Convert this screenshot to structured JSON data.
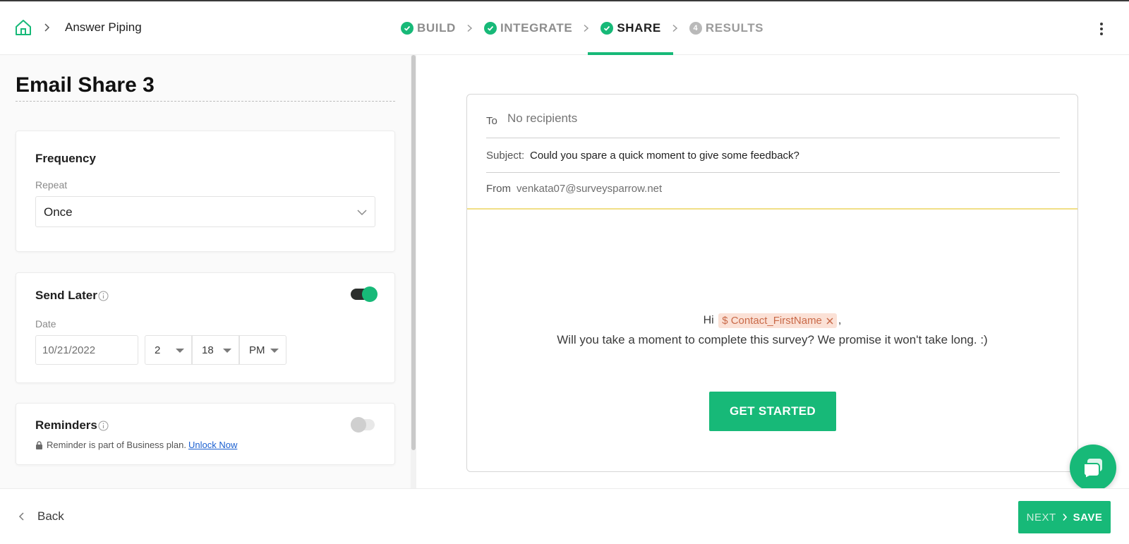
{
  "header": {
    "breadcrumb_title": "Answer Piping",
    "steps": [
      {
        "label": "BUILD",
        "state": "done"
      },
      {
        "label": "INTEGRATE",
        "state": "done"
      },
      {
        "label": "SHARE",
        "state": "active"
      },
      {
        "label": "RESULTS",
        "state": "todo",
        "number": "4"
      }
    ]
  },
  "left": {
    "title": "Email Share 3",
    "frequency": {
      "heading": "Frequency",
      "repeat_label": "Repeat",
      "repeat_value": "Once"
    },
    "send_later": {
      "heading": "Send Later",
      "enabled": true,
      "date_label": "Date",
      "date_value": "10/21/2022",
      "hour": "2",
      "minute": "18",
      "ampm": "PM"
    },
    "reminders": {
      "heading": "Reminders",
      "enabled": false,
      "note": "Reminder is part of Business plan.",
      "link": "Unlock Now"
    }
  },
  "email": {
    "to_label": "To",
    "to_placeholder": "No recipients",
    "subject_label": "Subject:",
    "subject_value": "Could you spare a quick moment to give some feedback?",
    "from_label": "From",
    "from_value": "venkata07@surveysparrow.net",
    "greeting": "Hi",
    "pipe_tag": "$ Contact_FirstName",
    "greeting_suffix": ",",
    "body": "Will you take a moment to complete this survey? We promise it won't take long. :)",
    "cta": "GET STARTED"
  },
  "footer": {
    "back": "Back",
    "next": "NEXT",
    "save": "SAVE"
  },
  "colors": {
    "accent": "#17b978",
    "pipe_tag_bg": "#fbe1d6",
    "pipe_tag_text": "#c96a49",
    "divider_yellow": "#f1df86"
  },
  "icons": [
    "home-icon",
    "chevron-right-icon",
    "check-circle-icon",
    "kebab-menu-icon",
    "chevron-down-icon",
    "info-icon",
    "lock-icon",
    "close-icon",
    "chat-icon",
    "chevron-left-icon"
  ]
}
